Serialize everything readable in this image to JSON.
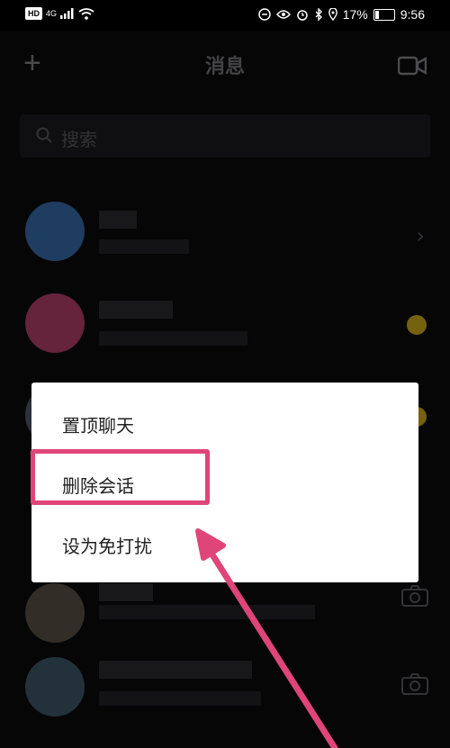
{
  "status_bar": {
    "hd": "HD",
    "network": "4G",
    "battery": "17%",
    "time": "9:56"
  },
  "header": {
    "title": "消息",
    "add_icon": "plus-icon",
    "video_icon": "video-camera-icon"
  },
  "search": {
    "placeholder": "搜索"
  },
  "context_menu": {
    "items": [
      {
        "label": "置顶聊天"
      },
      {
        "label": "删除会话"
      },
      {
        "label": "设为免打扰"
      }
    ],
    "highlighted_index": 1
  },
  "colors": {
    "highlight": "#e0457a",
    "badge": "#d6b21b"
  }
}
